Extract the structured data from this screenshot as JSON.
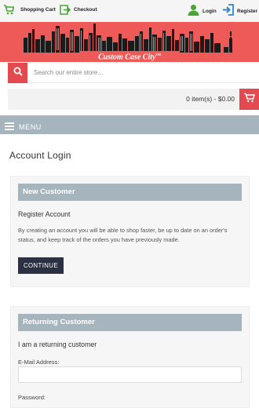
{
  "topbar": {
    "shopping_cart": "Shopping Cart",
    "checkout": "Checkout",
    "login": "Login",
    "register": "Register"
  },
  "header": {
    "logo_text": "Custom Case City",
    "logo_tm": "TM"
  },
  "search": {
    "placeholder": "Search our entire store...",
    "value": ""
  },
  "cart": {
    "summary": "0 item(s) - $0.00"
  },
  "menu": {
    "label": "MENU"
  },
  "page": {
    "title": "Account Login"
  },
  "new_customer": {
    "heading": "New Customer",
    "subheading": "Register Account",
    "description": "By creating an account you will be able to shop faster, be up to date on an order's status, and keep track of the orders you have previously made.",
    "button": "CONTINUE"
  },
  "returning_customer": {
    "heading": "Returning Customer",
    "subheading": "I am a returning customer",
    "email_label": "E-Mail Address:",
    "email_value": "",
    "password_label": "Password:"
  },
  "colors": {
    "accent": "#e24a50",
    "banner": "#ed5a58",
    "menubar": "#a6b4be",
    "button": "#2b3142"
  },
  "icons": [
    "cart-icon",
    "checkout-icon",
    "user-icon",
    "register-icon",
    "search-icon",
    "cart-icon",
    "hamburger-icon"
  ]
}
